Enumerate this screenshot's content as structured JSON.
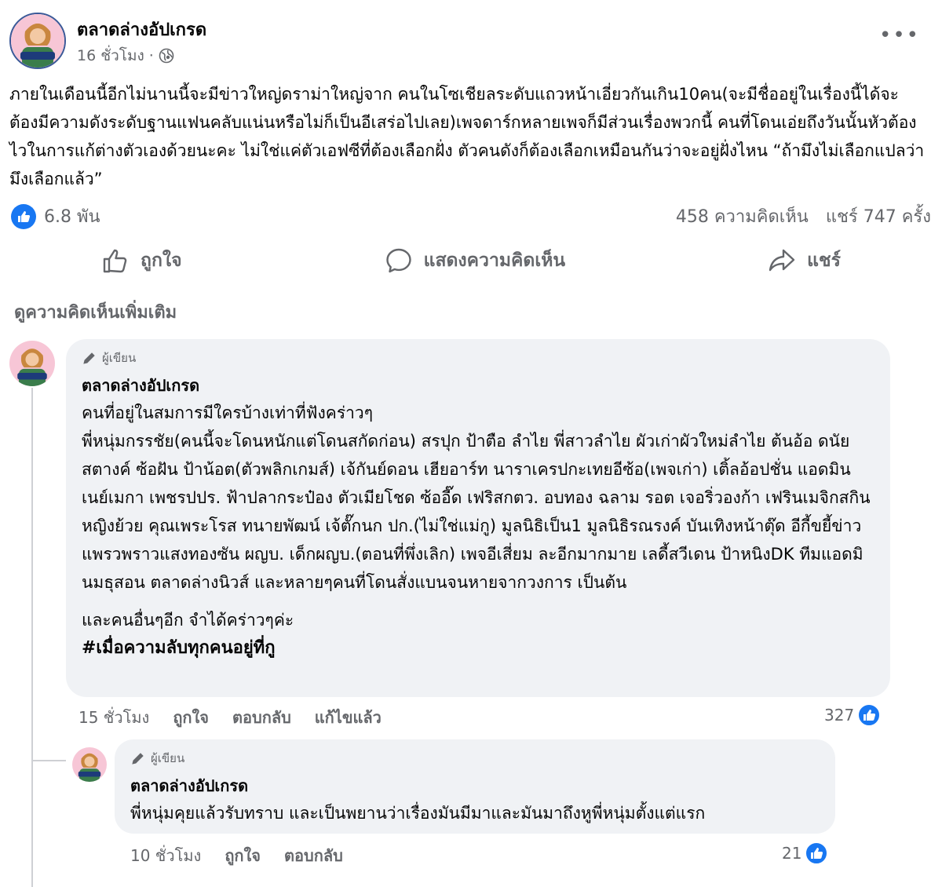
{
  "post": {
    "author": "ตลาดล่างอัปเกรด",
    "time": "16 ชั่วโมง",
    "separator": "·",
    "privacy_icon": "globe-icon",
    "more_label": "•••",
    "body": "ภายในเดือนนี้อีกไม่นานนี้จะมีข่าวใหญ่ดราม่าใหญ่จาก คนในโซเชียลระดับแถวหน้าเอี่ยวกันเกิน10คน(จะมีชื่ออยู่ในเรื่องนี้ได้จะต้องมีความดังระดับฐานแฟนคลับแน่นหรือไม่ก็เป็นอีเสร่อไปเลย)เพจดาร์กหลายเพจก็มีส่วนเรื่องพวกนี้ คนที่โดนเอ่ยถึงวันนั้นหัวต้องไวในการแก้ต่างตัวเองด้วยนะคะ ไม่ใช่แค่ตัวเอฟซีที่ต้องเลือกฝั่ง ตัวคนดังก็ต้องเลือกเหมือนกันว่าจะอยู่ฝั่งไหน “ถ้ามึงไม่เลือกแปลว่ามึงเลือกแล้ว”"
  },
  "stats": {
    "likes": "6.8 พัน",
    "comments": "458 ความคิดเห็น",
    "shares": "แชร์ 747 ครั้ง"
  },
  "actions": {
    "like": "ถูกใจ",
    "comment": "แสดงความคิดเห็น",
    "share": "แชร์"
  },
  "more_comments": "ดูความคิดเห็นเพิ่มเติม",
  "comments": [
    {
      "badge": "ผู้เขียน",
      "author": "ตลาดล่างอัปเกรด",
      "lines": [
        "คนที่อยู่ในสมการมีใครบ้างเท่าที่ฟังคร่าวๆ",
        "พี่หนุ่มกรรชัย(คนนี้จะโดนหนักแต่โดนสกัดก่อน) สรปุก ป้าตือ ลำไย พี่สาวลำไย ผัวเก่าผัวใหม่ลำไย ต้นอ้อ ดนัย สตางค์ ซ้อฝัน ป้าน้อต(ตัวพลิกเกมส์) เจ้กันย์ดอน เฮียอาร์ท นาราเครปกะเทยอีซ้อ(เพจเก่า) เติ้ลอ้อปชั่น แอดมินเนย์เมกา เพชรปปร. ฟ้าปลากระป๋อง ตัวเมียโชด ซ้ออี๊ด เฟริสกตว. อบทอง ฉลาม รอต เจอริ่วองก้า เฟรินเมจิกสกิน หญิงย้วย คุณเพระโรส ทนายพัฒน์ เจ้ตั๊กนก ปก.(ไม่ใช่แม่กู) มูลนิธิเป็น1 มูลนิธิรณรงค์ บันเทิงหน้าตุ๊ด อีกี้ขยี้ข่าว แพรวพราวแสงทองซัน ผญบ. เด็กผญบ.(ตอนที่พึ่งเลิก) เพจอีเสี่ยม ละอีกมากมาย เลดี้สวีเดน ป้าหนิงDK ทีมแอดมินมธุสอน ตลาดล่างนิวส์ และหลายๆคนที่โดนสั่งแบนจนหายจากวงการ เป็นต้น"
      ],
      "extra": "และคนอื่นๆอีก จำได้คร่าวๆค่ะ",
      "hashtag": "#เมื่อความลับทุกคนอยู่ที่กู",
      "time": "15 ชั่วโมง",
      "like": "ถูกใจ",
      "reply": "ตอบกลับ",
      "edited": "แก้ไขแล้ว",
      "reactions": "327"
    },
    {
      "badge": "ผู้เขียน",
      "author": "ตลาดล่างอัปเกรด",
      "text": "พี่หนุ่มคุยแล้วรับทราบ และเป็นพยานว่าเรื่องมันมีมาและมันมาถึงหูพี่หนุ่มตั้งแต่แรก",
      "time": "10 ชั่วโมง",
      "like": "ถูกใจ",
      "reply": "ตอบกลับ",
      "reactions": "21"
    }
  ],
  "colors": {
    "accent": "#1877f2",
    "bubble": "#f0f2f5",
    "secondary_text": "#65676b"
  }
}
